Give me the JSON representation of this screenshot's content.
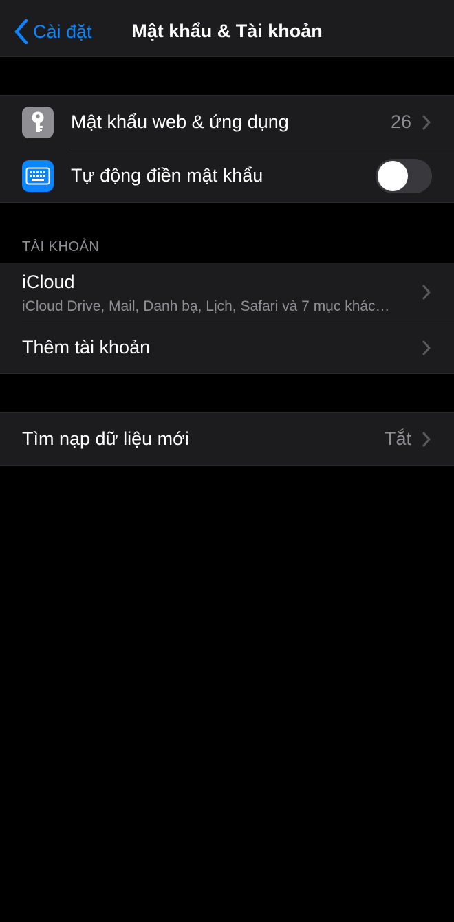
{
  "nav": {
    "back_label": "Cài đặt",
    "title": "Mật khẩu & Tài khoản"
  },
  "passwords_group": {
    "items": [
      {
        "label": "Mật khẩu web & ứng dụng",
        "value": "26",
        "icon": "key-icon"
      },
      {
        "label": "Tự động điền mật khẩu",
        "toggle_on": false,
        "icon": "keyboard-icon"
      }
    ]
  },
  "accounts_section": {
    "header": "TÀI KHOẢN",
    "icloud": {
      "label": "iCloud",
      "subtitle": "iCloud Drive, Mail, Danh bạ, Lịch, Safari và 7 mục khác…"
    },
    "add_account": {
      "label": "Thêm tài khoản"
    }
  },
  "fetch_group": {
    "label": "Tìm nạp dữ liệu mới",
    "value": "Tắt"
  },
  "colors": {
    "accent": "#0a84ff",
    "background": "#000000",
    "cell": "#1c1c1e",
    "secondary_text": "#8e8e93"
  }
}
